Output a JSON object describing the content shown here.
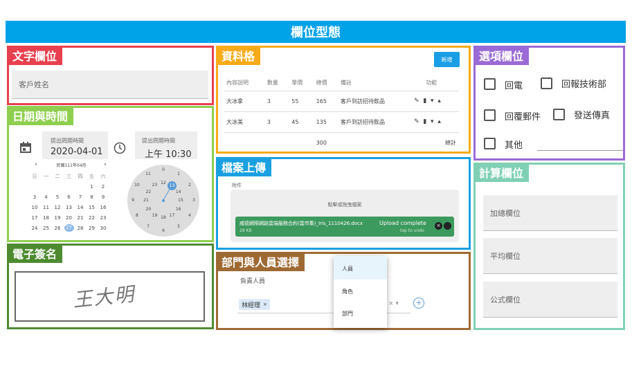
{
  "banner": {
    "title": "欄位型態"
  },
  "colors": {
    "banner": "#00a2e8",
    "text_panel": "#e8404f",
    "date_panel": "#8fcf4f",
    "sign_panel": "#4e8b30",
    "grid_panel": "#f7ab18",
    "upload_panel": "#1aa0e0",
    "dept_panel": "#9e6a34",
    "options_panel": "#9a6ad6",
    "calc_panel": "#7fd0b4"
  },
  "text_field": {
    "title": "文字欄位",
    "field_label": "客戶姓名"
  },
  "datetime": {
    "title": "日期與時間",
    "date_label": "提出問題時間",
    "date_value": "2020-04-01",
    "time_label": "提出問題時間",
    "time_value": "上午 10:30",
    "calendar": {
      "prev": "‹",
      "month": "民國111年04月",
      "next": "›",
      "weekdays": [
        "日",
        "一",
        "二",
        "三",
        "四",
        "五",
        "六"
      ],
      "rows": [
        [
          "",
          "",
          "",
          "",
          "",
          "1",
          "2"
        ],
        [
          "3",
          "4",
          "5",
          "6",
          "7",
          "8",
          "9"
        ],
        [
          "10",
          "11",
          "12",
          "13",
          "14",
          "15",
          "16"
        ],
        [
          "17",
          "18",
          "19",
          "20",
          "21",
          "22",
          "23"
        ],
        [
          "24",
          "25",
          "26",
          "27",
          "28",
          "29",
          "30"
        ]
      ],
      "selected": "27"
    },
    "clock": {
      "outer": [
        "0",
        "1",
        "2",
        "3",
        "4",
        "5",
        "6",
        "7",
        "8",
        "9",
        "10",
        "11"
      ],
      "inner": [
        "12",
        "13",
        "14",
        "15",
        "16",
        "17",
        "18",
        "19",
        "20",
        "21",
        "22",
        "23"
      ],
      "selected": "13"
    }
  },
  "signature": {
    "title": "電子簽名",
    "text": "王大明"
  },
  "grid": {
    "title": "資料格",
    "add_button": "新增",
    "headers": [
      "內容說明",
      "數量",
      "單價",
      "總價",
      "備註",
      "",
      "功能"
    ],
    "rows": [
      [
        "大冰拿",
        "3",
        "55",
        "165",
        "客戶到訪招待飲品"
      ],
      [
        "大冰美",
        "3",
        "45",
        "135",
        "客戶到訪招待飲品"
      ]
    ],
    "total_value": "300",
    "total_label": "總計"
  },
  "upload": {
    "title": "檔案上傳",
    "label": "附件",
    "drop_text": "點擊或拖曳檔案",
    "file_name": "威德網際網路雲端服務合約(雲市集)_Iris_1110426.docx",
    "file_size": "28 KB",
    "status": "Upload complete",
    "undo": "tap to undo"
  },
  "dept": {
    "title": "部門與人員選擇",
    "label": "負責人員",
    "chip": "林經理",
    "chip_remove": "×",
    "menu": [
      "人員",
      "角色",
      "部門"
    ],
    "add": "+"
  },
  "options": {
    "title": "選項欄位",
    "items": [
      "回電",
      "回報技術部",
      "回覆郵件",
      "發送傳真",
      "其他"
    ]
  },
  "calc": {
    "title": "計算欄位",
    "fields": [
      "加總欄位",
      "平均欄位",
      "公式欄位"
    ]
  }
}
